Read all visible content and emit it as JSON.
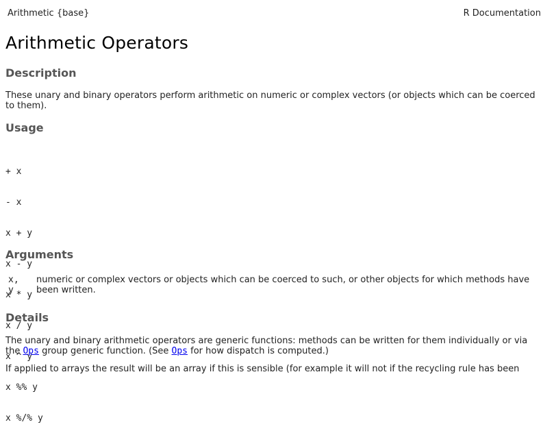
{
  "header": {
    "left": "Arithmetic {base}",
    "right": "R Documentation"
  },
  "title": "Arithmetic Operators",
  "sections": {
    "description": {
      "heading": "Description",
      "text": "These unary and binary operators perform arithmetic on numeric or complex vectors (or objects which can be coerced to them)."
    },
    "usage": {
      "heading": "Usage",
      "lines": [
        "+ x",
        "- x",
        "x + y",
        "x - y",
        "x * y",
        "x / y",
        "x ^ y",
        "x %% y",
        "x %/% y"
      ]
    },
    "arguments": {
      "heading": "Arguments",
      "name": "x, y",
      "desc": "numeric or complex vectors or objects which can be coerced to such, or other objects for which methods have been written."
    },
    "details": {
      "heading": "Details",
      "p1_a": "The unary and binary arithmetic operators are generic functions: methods can be written for them individually or via the ",
      "p1_link1": "Ops",
      "p1_b": " group generic function. (See ",
      "p1_link2": "Ops",
      "p1_c": " for how dispatch is computed.)",
      "p2": "If applied to arrays the result will be an array if this is sensible (for example it will not if the recycling rule has been"
    }
  }
}
